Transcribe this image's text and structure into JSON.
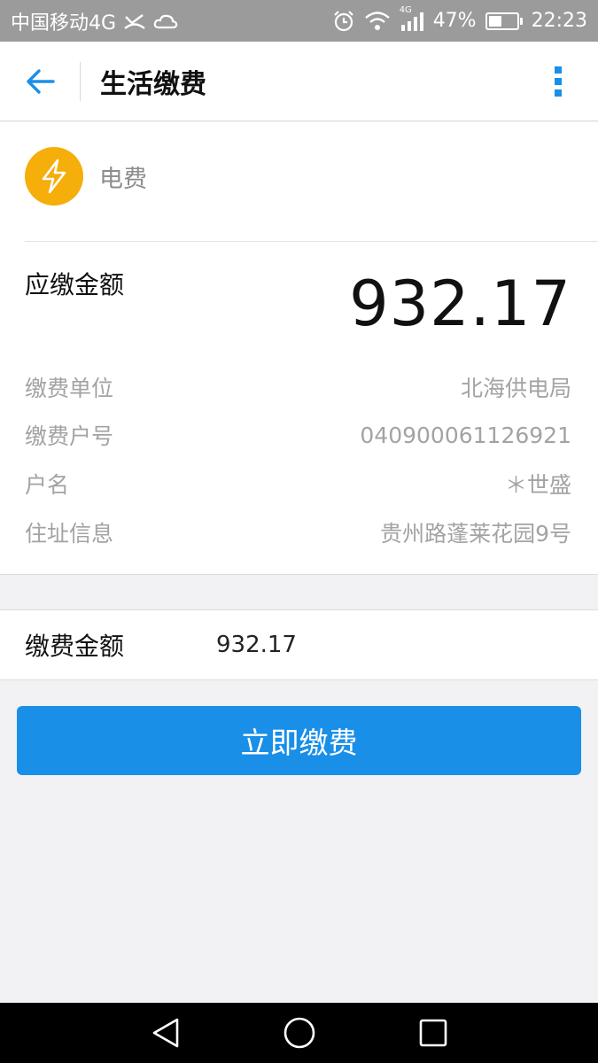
{
  "status_bar": {
    "carrier": "中国移动4G",
    "signal_label": "4G",
    "battery": "47%",
    "battery_level": 0.47,
    "time": "22:23"
  },
  "app_bar": {
    "title": "生活缴费"
  },
  "bill": {
    "biller_type": "电费",
    "amount_due_label": "应缴金额",
    "amount_due": "932.17",
    "details": [
      {
        "label": "缴费单位",
        "value": "北海供电局"
      },
      {
        "label": "缴费户号",
        "value": "040900061126921"
      },
      {
        "label": "户名",
        "value": "＊世盛"
      },
      {
        "label": "住址信息",
        "value": "贵州路蓬莱花园9号"
      }
    ]
  },
  "payment": {
    "amount_label": "缴费金额",
    "amount_value": "932.17",
    "submit_label": "立即缴费"
  },
  "colors": {
    "accent": "#1a8fe8",
    "biller_icon_bg": "#f5ae0a",
    "status_bar": "#9b9b9b"
  },
  "icons": {
    "back": "arrow-left-icon",
    "more": "more-vertical-icon",
    "biller": "lightning-icon"
  }
}
